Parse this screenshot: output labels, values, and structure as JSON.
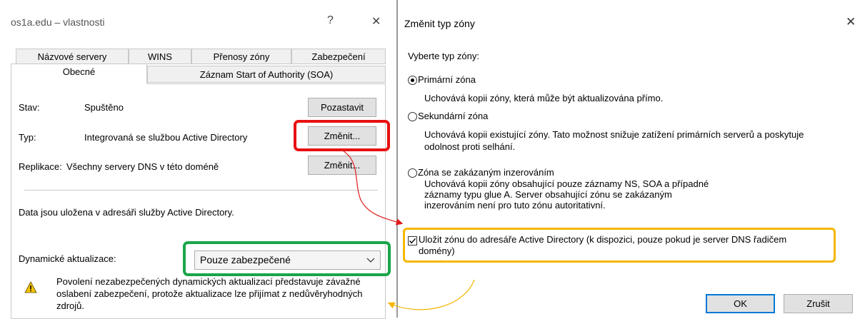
{
  "left_dialog": {
    "title": "os1a.edu – vlastnosti",
    "help_glyph": "?",
    "close_glyph": "✕",
    "tabs_row1": [
      "Názvové servery",
      "WINS",
      "Přenosy zóny",
      "Zabezpečení"
    ],
    "tabs_row2": [
      "Obecné",
      "Záznam Start of Authority (SOA)"
    ],
    "status_label": "Stav:",
    "status_value": "Spuštěno",
    "pause_button": "Pozastavit",
    "type_label": "Typ:",
    "type_value": "Integrovaná se službou Active Directory",
    "change_type_button": "Změnit...",
    "replication_label": "Replikace:",
    "replication_value": "Všechny servery DNS v této doméně",
    "change_replication_button": "Změnit...",
    "storage_info": "Data jsou uložena v adresáři služby Active Directory.",
    "dynamic_updates_label": "Dynamické aktualizace:",
    "dynamic_updates_value": "Pouze zabezpečené",
    "warning_text": "Povolení nezabezpečených dynamických aktualizací představuje závažné oslabení zabezpečení, protože aktualizace lze přijímat z nedůvěryhodných zdrojů.",
    "warning_icon": "warning-icon"
  },
  "right_dialog": {
    "title": "Změnit typ zóny",
    "close_glyph": "✕",
    "prompt": "Vyberte typ zóny:",
    "options": [
      {
        "label": "Primární zóna",
        "description": "Uchovává kopii zóny, která může být aktualizována přímo.",
        "selected": true
      },
      {
        "label": "Sekundární zóna",
        "description": "Uchovává kopii existující zóny. Tato možnost snižuje zatížení primárních serverů a poskytuje odolnost proti selhání.",
        "selected": false
      },
      {
        "label": "Zóna se zakázaným inzerováním",
        "description": "Uchovává kopii zóny obsahující pouze záznamy NS, SOA a případné záznamy typu glue A. Server obsahující zónu se zakázaným inzerováním není pro tuto zónu autoritativní.",
        "selected": false
      }
    ],
    "ad_checkbox_label": "Uložit zónu do adresáře Active Directory (k dispozici, pouze pokud je server DNS řadičem domény)",
    "ad_checkbox_checked": true,
    "ok_button": "OK",
    "cancel_button": "Zrušit"
  },
  "colors": {
    "highlight_red": "#e81010",
    "highlight_green": "#1aa64a",
    "highlight_orange": "#f5b600",
    "arrow_red": "#e01b1b",
    "arrow_orange": "#f5b600",
    "button_focus": "#0078d7"
  }
}
